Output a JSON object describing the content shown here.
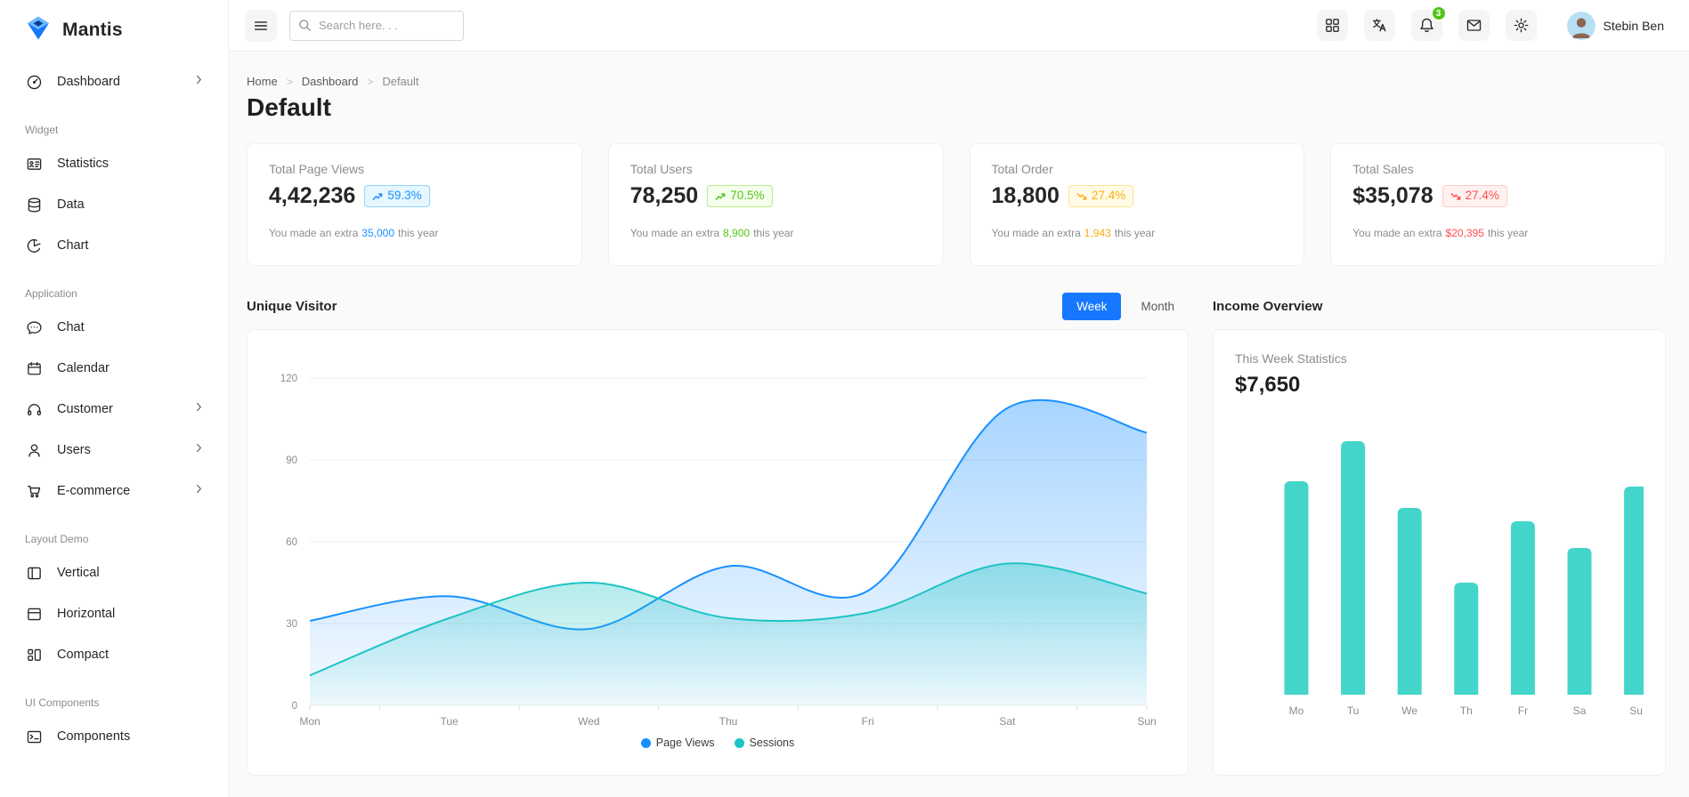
{
  "brand": {
    "name": "Mantis"
  },
  "header": {
    "search_placeholder": "Search here. . .",
    "notification_count": "3",
    "user_name": "Stebin Ben"
  },
  "breadcrumb": {
    "items": [
      "Home",
      "Dashboard",
      "Default"
    ]
  },
  "page_title": "Default",
  "sidebar": {
    "dashboard": {
      "label": "Dashboard"
    },
    "sections": [
      {
        "label": "Widget",
        "items": [
          {
            "label": "Statistics"
          },
          {
            "label": "Data"
          },
          {
            "label": "Chart"
          }
        ]
      },
      {
        "label": "Application",
        "items": [
          {
            "label": "Chat"
          },
          {
            "label": "Calendar"
          },
          {
            "label": "Customer"
          },
          {
            "label": "Users"
          },
          {
            "label": "E-commerce"
          }
        ]
      },
      {
        "label": "Layout Demo",
        "items": [
          {
            "label": "Vertical"
          },
          {
            "label": "Horizontal"
          },
          {
            "label": "Compact"
          }
        ]
      },
      {
        "label": "UI Components",
        "items": [
          {
            "label": "Components"
          }
        ]
      }
    ]
  },
  "cards": [
    {
      "title": "Total Page Views",
      "value": "4,42,236",
      "badge": "59.3%",
      "trend": "up",
      "color": "#1890ff",
      "extra_prefix": "You made an extra",
      "extra_value": "35,000",
      "extra_suffix": "this year"
    },
    {
      "title": "Total Users",
      "value": "78,250",
      "badge": "70.5%",
      "trend": "up",
      "color": "#52c41a",
      "extra_prefix": "You made an extra",
      "extra_value": "8,900",
      "extra_suffix": "this year"
    },
    {
      "title": "Total Order",
      "value": "18,800",
      "badge": "27.4%",
      "trend": "down",
      "color": "#faad14",
      "extra_prefix": "You made an extra",
      "extra_value": "1,943",
      "extra_suffix": "this year"
    },
    {
      "title": "Total Sales",
      "value": "$35,078",
      "badge": "27.4%",
      "trend": "down",
      "color": "#ff4d4f",
      "extra_prefix": "You made an extra",
      "extra_value": "$20,395",
      "extra_suffix": "this year"
    }
  ],
  "visitor": {
    "title": "Unique Visitor",
    "week_label": "Week",
    "month_label": "Month"
  },
  "income": {
    "title": "Income Overview",
    "subtitle": "This Week Statistics",
    "value": "$7,650"
  },
  "chart_data": [
    {
      "type": "area",
      "title": "Unique Visitor (Week)",
      "x": [
        "Mon",
        "Tue",
        "Wed",
        "Thu",
        "Fri",
        "Sat",
        "Sun"
      ],
      "series": [
        {
          "name": "Page Views",
          "color": "#1890ff",
          "values": [
            31,
            40,
            28,
            51,
            42,
            109,
            100
          ]
        },
        {
          "name": "Sessions",
          "color": "#1dc4c4",
          "values": [
            11,
            32,
            45,
            32,
            34,
            52,
            41
          ]
        }
      ],
      "ylim": [
        0,
        120
      ],
      "yticks": [
        0,
        30,
        60,
        90,
        120
      ],
      "grid": "horizontal",
      "legend_position": "bottom"
    },
    {
      "type": "bar",
      "title": "Income Overview - This Week Statistics",
      "categories": [
        "Mo",
        "Tu",
        "We",
        "Th",
        "Fr",
        "Sa",
        "Su"
      ],
      "values": [
        80,
        95,
        70,
        42,
        65,
        55,
        78
      ],
      "color": "#43d5ca",
      "ylim": [
        0,
        100
      ],
      "grid": false
    }
  ]
}
